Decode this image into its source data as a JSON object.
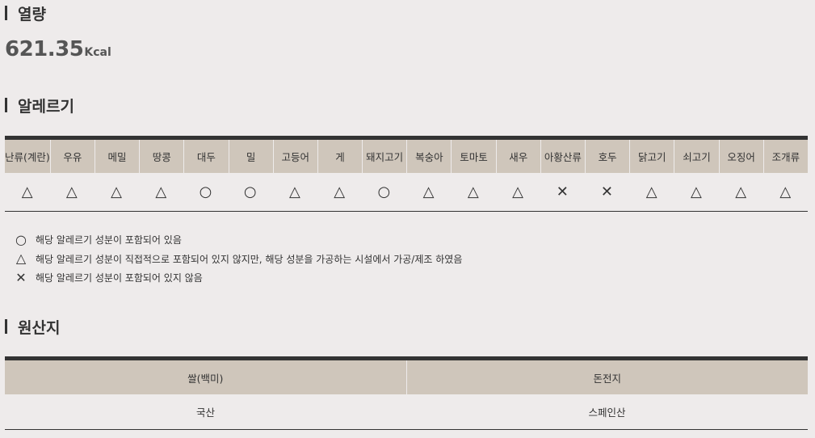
{
  "calorie": {
    "title": "열량",
    "value": "621.35",
    "unit": "Kcal"
  },
  "allergy": {
    "title": "알레르기",
    "headers": [
      "난류(계란)",
      "우유",
      "메밀",
      "땅콩",
      "대두",
      "밀",
      "고등어",
      "게",
      "돼지고기",
      "복숭아",
      "토마토",
      "새우",
      "아황산류",
      "호두",
      "닭고기",
      "쇠고기",
      "오징어",
      "조개류"
    ],
    "values": [
      "△",
      "△",
      "△",
      "△",
      "○",
      "○",
      "△",
      "△",
      "○",
      "△",
      "△",
      "△",
      "✕",
      "✕",
      "△",
      "△",
      "△",
      "△"
    ],
    "legend": [
      {
        "symbol": "○",
        "icon": "circle-icon",
        "text": "해당 알레르기 성분이 포함되어 있음"
      },
      {
        "symbol": "△",
        "icon": "triangle-icon",
        "text": "해당 알레르기 성분이 직접적으로 포함되어 있지 않지만, 해당 성분을 가공하는 시설에서 가공/제조 하였음"
      },
      {
        "symbol": "✕",
        "icon": "cross-icon",
        "text": "해당 알레르기 성분이 포함되어 있지 않음"
      }
    ]
  },
  "origin": {
    "title": "원산지",
    "headers": [
      "쌀(백미)",
      "돈전지"
    ],
    "values": [
      "국산",
      "스페인산"
    ]
  },
  "colors": {
    "background": "#eeebeb",
    "header_bg": "#cfc6bb",
    "rule": "#333333"
  }
}
